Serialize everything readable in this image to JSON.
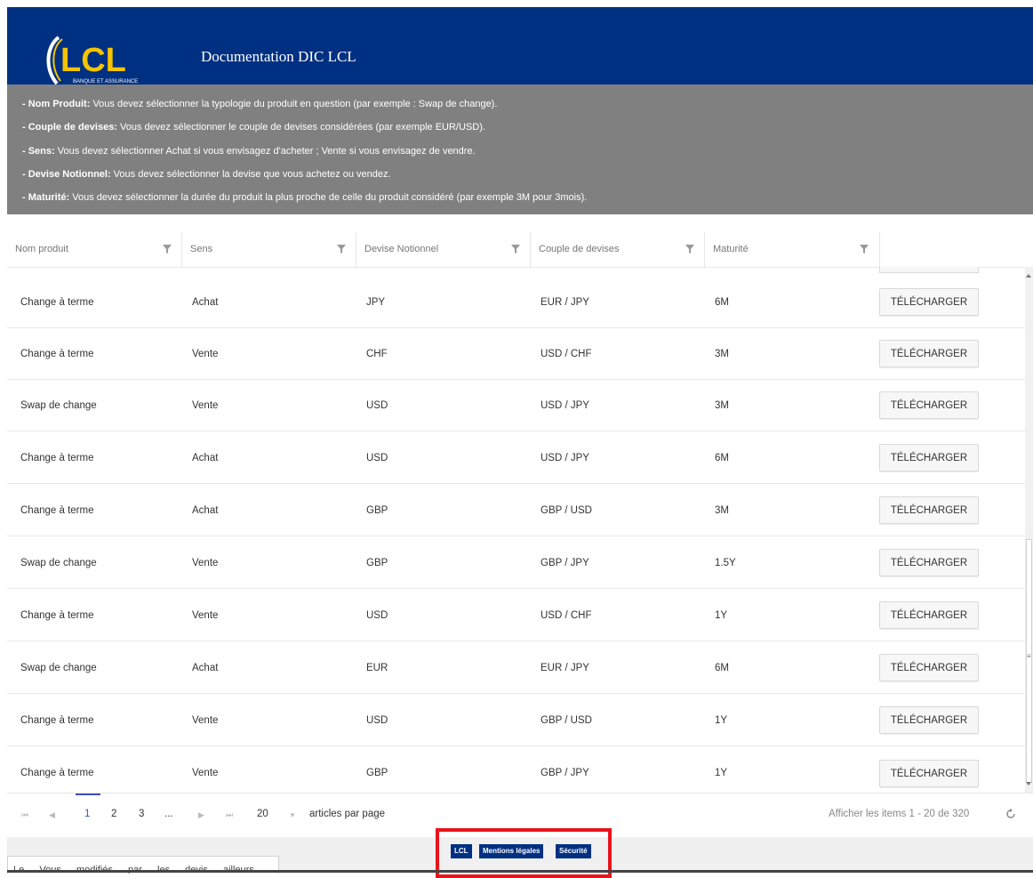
{
  "header": {
    "title": "Documentation DIC LCL",
    "logo_text": "LCL",
    "logo_subtext": "BANQUE ET ASSURANCE",
    "brand_color": "#003082"
  },
  "instructions": [
    {
      "label": "- Nom Produit:",
      "text": " Vous devez sélectionner la typologie du produit en question (par exemple : Swap de change)."
    },
    {
      "label": "- Couple de devises:",
      "text": " Vous devez sélectionner le couple de devises considérées (par exemple EUR/USD)."
    },
    {
      "label": "- Sens:",
      "text": " Vous devez sélectionner Achat si vous envisagez d'acheter ; Vente si vous envisagez de vendre."
    },
    {
      "label": "- Devise Notionnel:",
      "text": " Vous devez sélectionner la devise que vous achetez ou vendez."
    },
    {
      "label": "- Maturité:",
      "text": " Vous devez sélectionner la durée du produit la plus proche de celle du produit considéré (par exemple 3M pour 3mois)."
    }
  ],
  "grid": {
    "columns": [
      "Nom produit",
      "Sens",
      "Devise Notionnel",
      "Couple de devises",
      "Maturité"
    ],
    "filter_icon": "funnel-icon",
    "download_label": "TÉLÉCHARGER",
    "rows": [
      {
        "product": "Change à terme",
        "sens": "Achat",
        "devise": "JPY",
        "couple": "EUR / JPY",
        "maturite": "6M"
      },
      {
        "product": "Change à terme",
        "sens": "Vente",
        "devise": "CHF",
        "couple": "USD / CHF",
        "maturite": "3M"
      },
      {
        "product": "Swap de change",
        "sens": "Vente",
        "devise": "USD",
        "couple": "USD / JPY",
        "maturite": "3M"
      },
      {
        "product": "Change à terme",
        "sens": "Achat",
        "devise": "USD",
        "couple": "USD / JPY",
        "maturite": "6M"
      },
      {
        "product": "Change à terme",
        "sens": "Achat",
        "devise": "GBP",
        "couple": "GBP / USD",
        "maturite": "3M"
      },
      {
        "product": "Swap de change",
        "sens": "Vente",
        "devise": "GBP",
        "couple": "GBP / JPY",
        "maturite": "1.5Y"
      },
      {
        "product": "Change à terme",
        "sens": "Vente",
        "devise": "USD",
        "couple": "USD / CHF",
        "maturite": "1Y"
      },
      {
        "product": "Swap de change",
        "sens": "Achat",
        "devise": "EUR",
        "couple": "EUR / JPY",
        "maturite": "6M"
      },
      {
        "product": "Change à terme",
        "sens": "Vente",
        "devise": "USD",
        "couple": "GBP / USD",
        "maturite": "1Y"
      },
      {
        "product": "Change à terme",
        "sens": "Vente",
        "devise": "GBP",
        "couple": "GBP / JPY",
        "maturite": "1Y"
      }
    ]
  },
  "pager": {
    "first": "⏮",
    "prev": "◀",
    "pages": [
      "1",
      "2",
      "3",
      "..."
    ],
    "current_page": "1",
    "next": "▶",
    "last": "⏭",
    "page_size": "20",
    "page_size_suffix": "articles par page",
    "info": "Afficher les items 1 - 20 de 320",
    "refresh_icon": "refresh-icon"
  },
  "footer": {
    "links": [
      "LCL",
      "Mentions légales",
      "Sécurité"
    ],
    "partial_text": "Le … Vous … modifiés … par … les … devis … ailleurs",
    "highlight_color": "#e8141b"
  }
}
